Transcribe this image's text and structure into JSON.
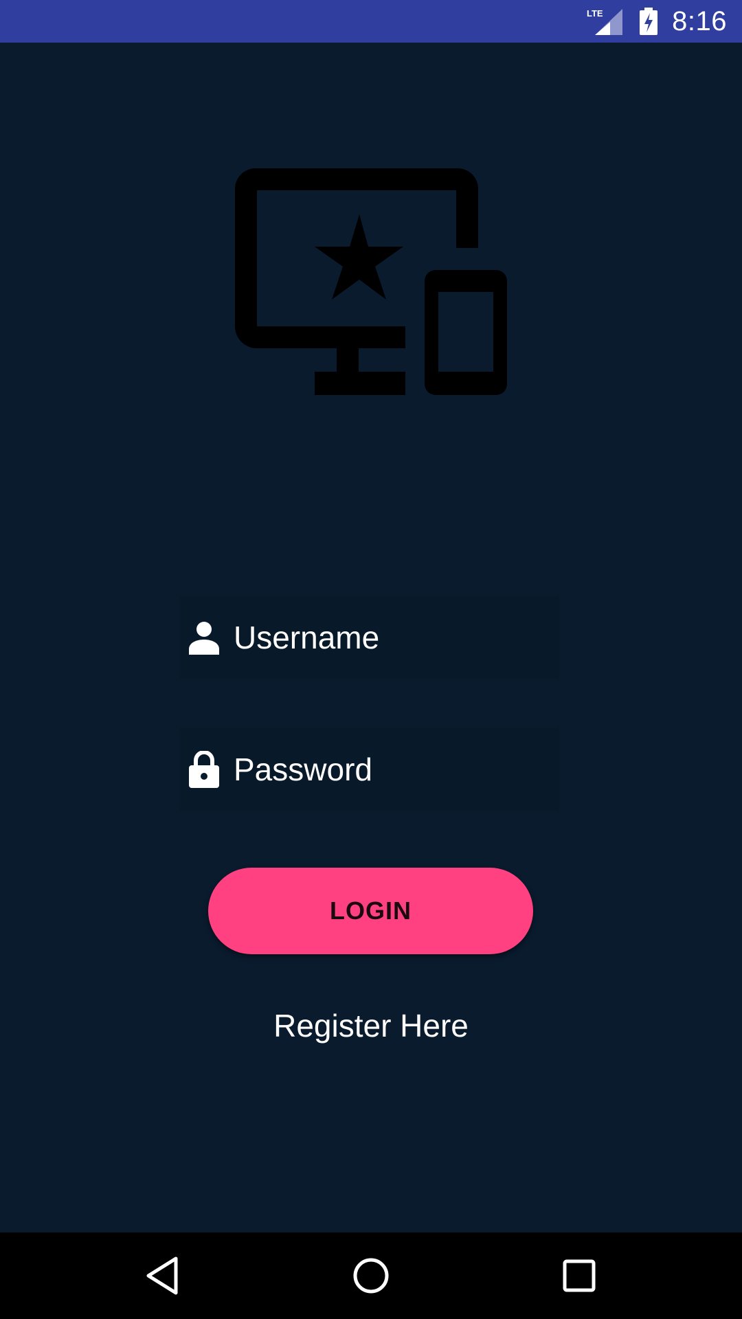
{
  "status_bar": {
    "time": "8:16",
    "network_label": "LTE",
    "icons": [
      "lte-signal-icon",
      "battery-charging-icon"
    ],
    "color": "#303f9f"
  },
  "logo": {
    "icon": "devices-star-icon"
  },
  "login_form": {
    "username": {
      "placeholder": "Username",
      "value": "",
      "icon": "person-icon"
    },
    "password": {
      "placeholder": "Password",
      "value": "",
      "icon": "lock-icon"
    },
    "login_label": "LOGIN",
    "register_label": "Register Here"
  },
  "nav_bar": {
    "icons": [
      "back-icon",
      "home-icon",
      "recents-icon"
    ]
  },
  "colors": {
    "background": "#0a1b2e",
    "field_background": "#08192a",
    "accent": "#ff4081",
    "status_bar": "#303f9f"
  }
}
